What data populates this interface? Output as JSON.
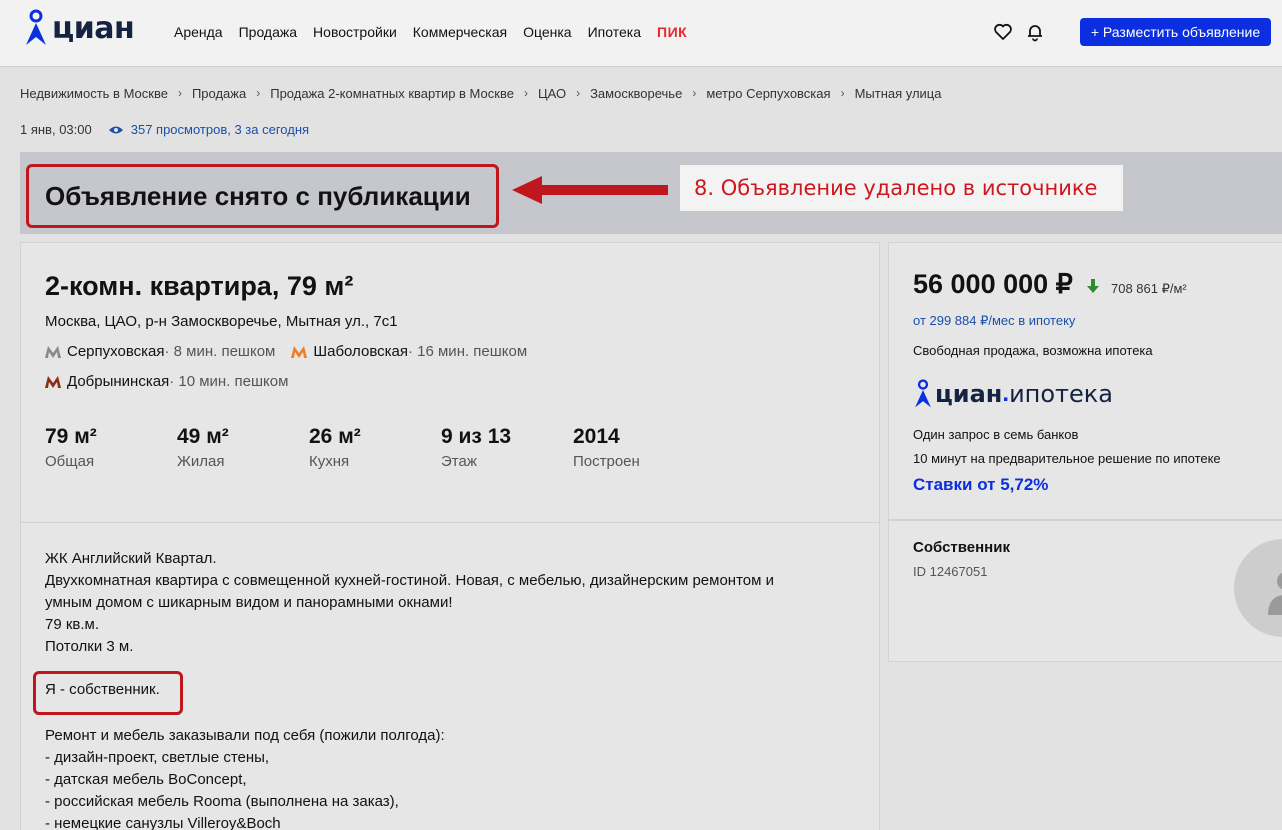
{
  "header": {
    "logo_text": "циан",
    "nav": [
      "Аренда",
      "Продажа",
      "Новостройки",
      "Коммерческая",
      "Оценка",
      "Ипотека",
      "ПИК"
    ],
    "place_ad": "+ Разместить объявление"
  },
  "breadcrumbs": [
    "Недвижимость в Москве",
    "Продажа",
    "Продажа 2-комнатных квартир в Москве",
    "ЦАО",
    "Замоскворечье",
    "метро Серпуховская",
    "Мытная улица"
  ],
  "meta": {
    "date": "1 янв, 03:00",
    "views": "357 просмотров, 3 за сегодня"
  },
  "banner": {
    "title": "Объявление снято с публикации",
    "annotation": "8. Объявление удалено в источнике"
  },
  "listing": {
    "title": "2-комн. квартира, 79 м²",
    "address": "Москва, ЦАО, р-н Замоскворечье, Мытная ул., 7с1",
    "metro": [
      {
        "name": "Серпуховская",
        "time": " · 8 мин. пешком",
        "color": "#8a8a8a"
      },
      {
        "name": "Шаболовская",
        "time": " · 16 мин. пешком",
        "color": "#f07e24"
      },
      {
        "name": "Добрынинская",
        "time": " · 10 мин. пешком",
        "color": "#8c2e13"
      }
    ],
    "facts": [
      {
        "value": "79 м²",
        "label": "Общая"
      },
      {
        "value": "49 м²",
        "label": "Жилая"
      },
      {
        "value": "26 м²",
        "label": "Кухня"
      },
      {
        "value": "9 из 13",
        "label": "Этаж"
      },
      {
        "value": "2014",
        "label": "Построен"
      }
    ],
    "description": [
      "ЖК Английский Квартал.",
      "Двухкомнатная квартира с совмещенной кухней-гостиной. Новая, с мебелью, дизайнерским ремонтом и",
      "умным домом с шикарным видом и панорамными окнами!",
      "79 кв.м.",
      "Потолки 3 м."
    ],
    "owner_note": "Я - собственник.",
    "description2": [
      "Ремонт и мебель заказывали под себя (пожили полгода):",
      "- дизайн-проект, светлые стены,",
      "- датская мебель BoConcept,",
      "- российская мебель Rooma (выполнена на заказ),",
      "- немецкие санузлы Villeroy&Boch"
    ]
  },
  "price": {
    "total": "56 000 000 ₽",
    "per_m2": "708 861 ₽/м²",
    "mortgage_link": "от 299 884 ₽/мес в ипотеку",
    "sale_type": "Свободная продажа, возможна ипотека",
    "ipoteka_logo_cian": "циан",
    "ipoteka_logo_dot": ".",
    "ipoteka_logo_ip": "ипотека",
    "banks_line1": "Один запрос в семь банков",
    "banks_line2": "10 минут на предварительное решение по ипотеке",
    "rates": "Ставки от 5,72%"
  },
  "owner": {
    "label": "Собственник",
    "id": "ID 12467051"
  },
  "colors": {
    "brand_blue": "#0b2fe0",
    "annotation_red": "#c0171e",
    "price_down_green": "#2e8b2e"
  }
}
